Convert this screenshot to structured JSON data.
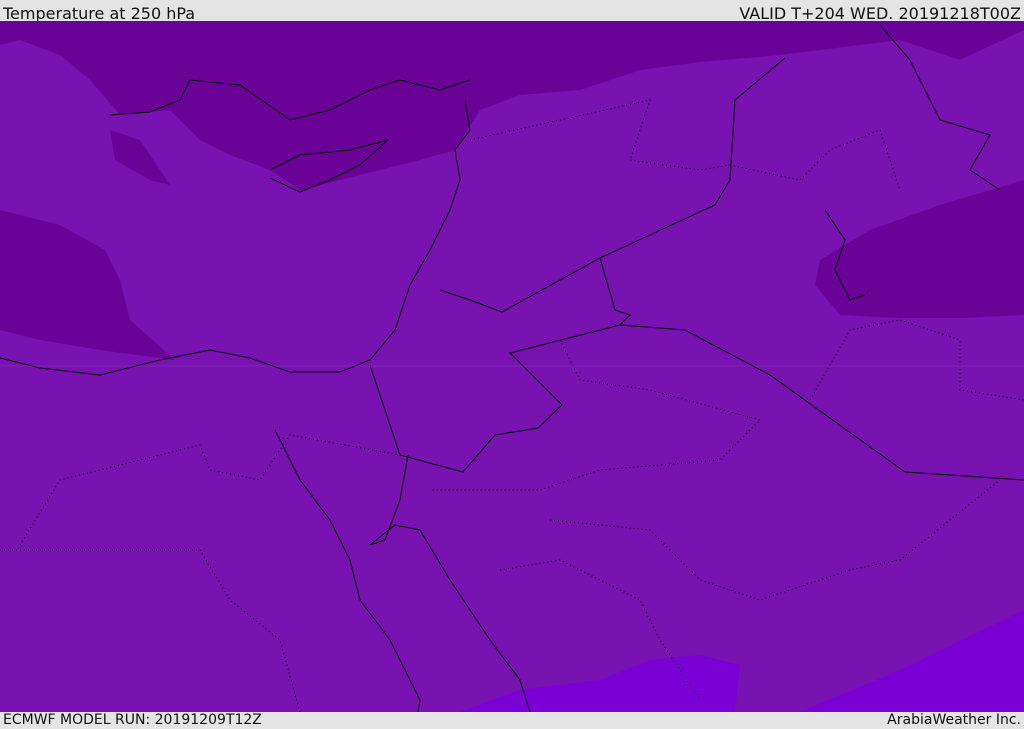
{
  "header": {
    "title": "Temperature at 250 hPa",
    "valid": "VALID T+204 WED. 20191218T00Z"
  },
  "footer": {
    "model_run": "ECMWF MODEL RUN: 20191209T12Z",
    "credit": "ArabiaWeather Inc."
  },
  "colors": {
    "base": "#7812b0",
    "cold": "#6a0298",
    "warm": "#7b00d6",
    "border": "#000000"
  }
}
